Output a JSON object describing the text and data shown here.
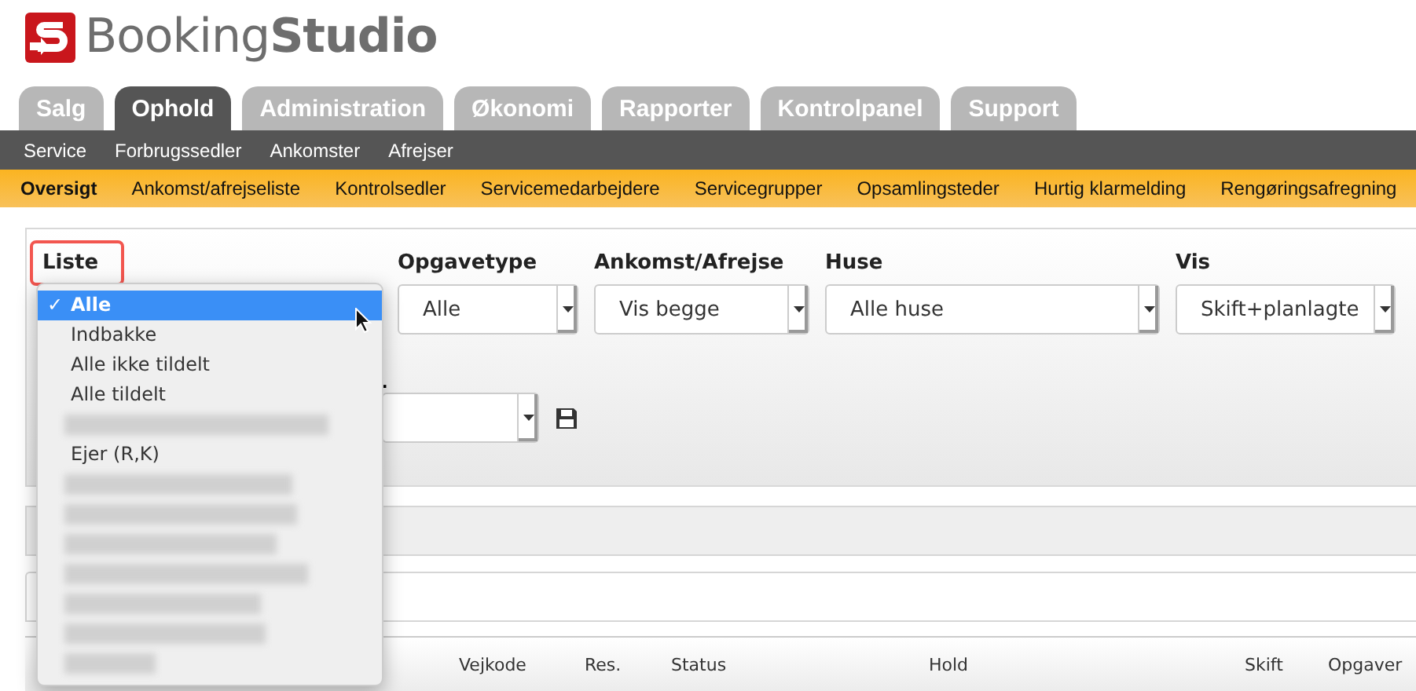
{
  "logo": {
    "text_light": "Booking",
    "text_bold": "Studio"
  },
  "tabs": [
    {
      "label": "Salg",
      "selected": false
    },
    {
      "label": "Ophold",
      "selected": true
    },
    {
      "label": "Administration",
      "selected": false
    },
    {
      "label": "Økonomi",
      "selected": false
    },
    {
      "label": "Rapporter",
      "selected": false
    },
    {
      "label": "Kontrolpanel",
      "selected": false
    },
    {
      "label": "Support",
      "selected": false
    }
  ],
  "subnav": [
    "Service",
    "Forbrugssedler",
    "Ankomster",
    "Afrejser"
  ],
  "subnav2": [
    {
      "label": "Oversigt",
      "selected": true
    },
    {
      "label": "Ankomst/afrejseliste",
      "selected": false
    },
    {
      "label": "Kontrolsedler",
      "selected": false
    },
    {
      "label": "Servicemedarbejdere",
      "selected": false
    },
    {
      "label": "Servicegrupper",
      "selected": false
    },
    {
      "label": "Opsamlingsteder",
      "selected": false
    },
    {
      "label": "Hurtig klarmelding",
      "selected": false
    },
    {
      "label": "Rengøringsafregning",
      "selected": false
    }
  ],
  "filters": [
    {
      "label": "Liste",
      "highlighted": true
    },
    {
      "label": "Opgavetype",
      "value": "Alle",
      "highlighted": false
    },
    {
      "label": "Ankomst/Afrejse",
      "value": "Vis begge",
      "highlighted": false
    },
    {
      "label": "Huse",
      "value": "Alle huse",
      "highlighted": false
    },
    {
      "label": "Vis",
      "value": "Skift+planlagte",
      "highlighted": false
    }
  ],
  "row2_label": ".",
  "dropdown": [
    {
      "kind": "text",
      "label": "Alle",
      "selected": true
    },
    {
      "kind": "text",
      "label": "Indbakke",
      "selected": false
    },
    {
      "kind": "text",
      "label": "Alle ikke tildelt",
      "selected": false
    },
    {
      "kind": "text",
      "label": "Alle tildelt",
      "selected": false
    },
    {
      "kind": "redacted",
      "selected": false
    },
    {
      "kind": "text",
      "label": "Ejer (R,K)",
      "selected": false
    },
    {
      "kind": "redacted",
      "selected": false
    },
    {
      "kind": "redacted",
      "selected": false
    },
    {
      "kind": "redacted",
      "selected": false
    },
    {
      "kind": "redacted",
      "selected": false
    },
    {
      "kind": "redacted",
      "selected": false
    },
    {
      "kind": "redacted",
      "selected": false
    },
    {
      "kind": "redacted",
      "selected": false
    }
  ],
  "check_mark": "✓",
  "table": {
    "columns": [
      "Vejkode",
      "Res.",
      "Status",
      "Hold",
      "Skift",
      "Opgaver"
    ]
  }
}
